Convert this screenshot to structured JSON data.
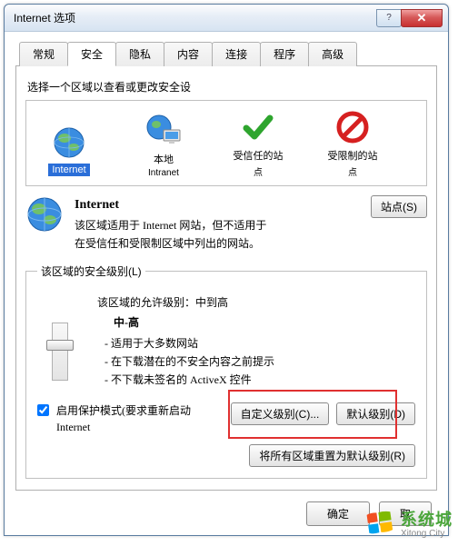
{
  "window": {
    "title": "Internet 选项"
  },
  "tabs": [
    "常规",
    "安全",
    "隐私",
    "内容",
    "连接",
    "程序",
    "高级"
  ],
  "active_tab_index": 1,
  "security": {
    "zone_select_label": "选择一个区域以查看或更改安全设",
    "zones": [
      {
        "label": "Internet",
        "sub": ""
      },
      {
        "label": "本地",
        "sub": "Intranet"
      },
      {
        "label": "受信任的站",
        "sub": "点"
      },
      {
        "label": "受限制的站",
        "sub": "点"
      }
    ],
    "selected_zone_index": 0,
    "zone_name": "Internet",
    "zone_desc1": "该区域适用于 Internet 网站，但不适用于",
    "zone_desc2": "在受信任和受限制区域中列出的网站。",
    "sites_button": "站点(S)",
    "level_group": "该区域的安全级别(L)",
    "allowed_label": "该区域的允许级别：中到高",
    "level_name": "中-高",
    "bullets": [
      "- 适用于大多数网站",
      "- 在下载潜在的不安全内容之前提示",
      "- 不下载未签名的 ActiveX 控件"
    ],
    "protected_mode": "启用保护模式(要求重新启动 Internet",
    "custom_level_btn": "自定义级别(C)...",
    "default_level_btn": "默认级别(D)",
    "reset_all_btn": "将所有区域重置为默认级别(R)"
  },
  "buttons": {
    "ok": "确定",
    "cancel": "取"
  },
  "watermark": {
    "line1": "系统城",
    "line2": "Xitong City"
  },
  "colors": {
    "accent": "#2a6ed8",
    "highlight": "#e03030"
  }
}
